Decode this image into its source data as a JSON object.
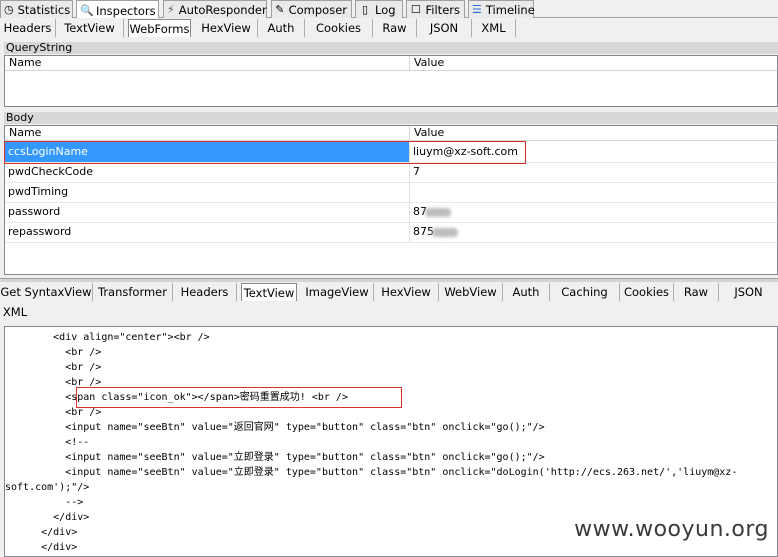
{
  "top_tabs": [
    {
      "label": "Statistics",
      "icon": "stopwatch-icon"
    },
    {
      "label": "Inspectors",
      "icon": "inspector-icon"
    },
    {
      "label": "AutoResponder",
      "icon": "lightning-icon"
    },
    {
      "label": "Composer",
      "icon": "pencil-icon"
    },
    {
      "label": "Log",
      "icon": "document-icon"
    },
    {
      "label": "Filters",
      "icon": "checkbox-icon"
    },
    {
      "label": "Timeline",
      "icon": "timeline-icon"
    }
  ],
  "request_tabs": [
    "Headers",
    "TextView",
    "WebForms",
    "HexView",
    "Auth",
    "Cookies",
    "Raw",
    "JSON",
    "XML"
  ],
  "querystring": {
    "title": "QueryString",
    "col_name": "Name",
    "col_value": "Value"
  },
  "body": {
    "title": "Body",
    "col_name": "Name",
    "col_value": "Value",
    "rows": [
      {
        "name": "ccsLoginName",
        "value": "liuym@xz-soft.com"
      },
      {
        "name": "pwdCheckCode",
        "value": "7"
      },
      {
        "name": "pwdTiming",
        "value": ""
      },
      {
        "name": "password",
        "value": "87"
      },
      {
        "name": "repassword",
        "value": "875"
      }
    ]
  },
  "response_tabs_row1": [
    "Get SyntaxView",
    "Transformer",
    "Headers",
    "TextView",
    "ImageView",
    "HexView",
    "WebView",
    "Auth",
    "Caching",
    "Cookies",
    "Raw",
    "JSON"
  ],
  "response_tabs_row2": [
    "XML"
  ],
  "response_code": [
    "        <div align=\"center\"><br />",
    "          <br />",
    "          <br />",
    "          <br />",
    "          <span class=\"icon_ok\"></span>密码重置成功! <br />",
    "          <br />",
    "          <input name=\"seeBtn\" value=\"返回官网\" type=\"button\" class=\"btn\" onclick=\"go();\"/>",
    "          <!--",
    "          <input name=\"seeBtn\" value=\"立即登录\" type=\"button\" class=\"btn\" onclick=\"go();\"/>",
    "          <input name=\"seeBtn\" value=\"立即登录\" type=\"button\" class=\"btn\" onclick=\"doLogin('http://ecs.263.net/','liuym@xz-",
    "soft.com');\"/>",
    "          -->",
    "        </div>",
    "      </div>",
    "      </div>"
  ],
  "watermark": "www.wooyun.org"
}
